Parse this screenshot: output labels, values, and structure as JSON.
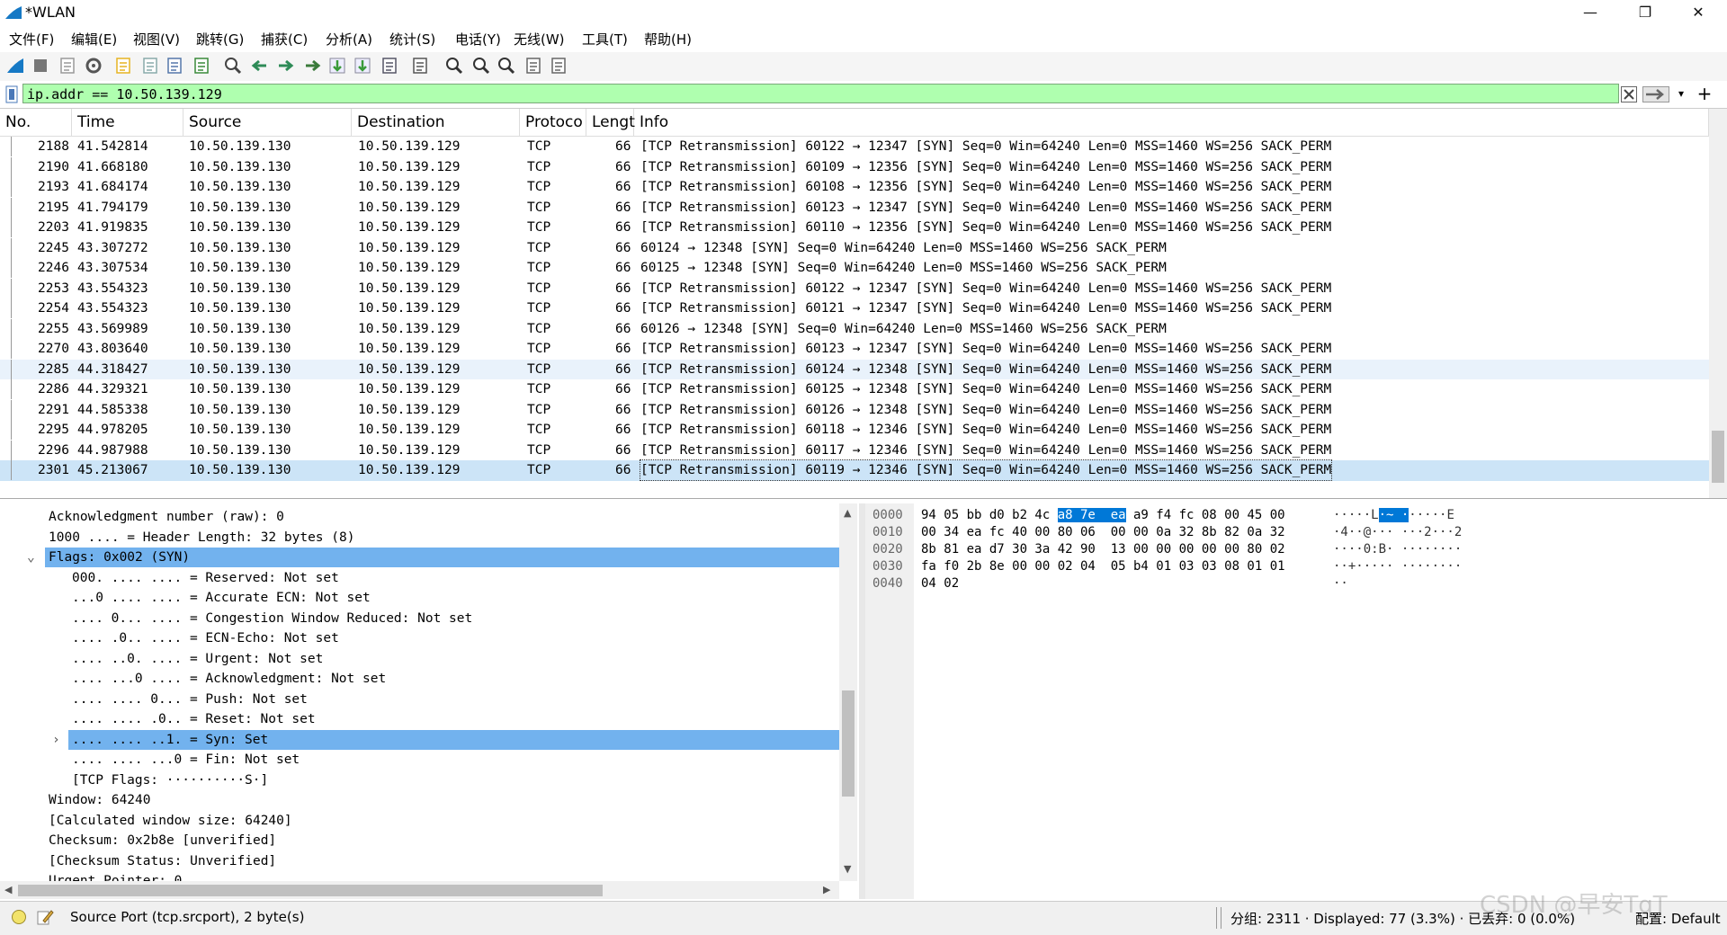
{
  "window": {
    "title": "*WLAN",
    "min_glyph": "—",
    "max_glyph": "❐",
    "close_glyph": "✕"
  },
  "menu": [
    "文件(F)",
    "编辑(E)",
    "视图(V)",
    "跳转(G)",
    "捕获(C)",
    "分析(A)",
    "统计(S)",
    "电话(Y)",
    "无线(W)",
    "工具(T)",
    "帮助(H)"
  ],
  "toolbar_icons": [
    "shark-fin-start-icon",
    "stop-capture-icon",
    "restart-capture-icon",
    "capture-options-icon",
    "open-file-icon",
    "save-file-icon",
    "close-file-icon",
    "reload-icon",
    "find-icon",
    "go-back-icon",
    "go-forward-icon",
    "go-to-packet-icon",
    "first-packet-icon",
    "last-packet-icon",
    "auto-scroll-icon",
    "colorize-icon",
    "zoom-in-icon",
    "zoom-out-icon",
    "zoom-reset-icon",
    "resize-columns-icon",
    "layout-icon"
  ],
  "filter": {
    "value": "ip.addr == 10.50.139.129",
    "plus": "+"
  },
  "packet_list": {
    "columns": [
      "No.",
      "Time",
      "Source",
      "Destination",
      "Protoco",
      "Lengt",
      "Info"
    ],
    "rows": [
      {
        "no": "2188",
        "time": "41.542814",
        "src": "10.50.139.130",
        "dst": "10.50.139.129",
        "proto": "TCP",
        "len": "66",
        "info": "[TCP Retransmission] 60122 → 12347 [SYN] Seq=0 Win=64240 Len=0 MSS=1460 WS=256 SACK_PERM"
      },
      {
        "no": "2190",
        "time": "41.668180",
        "src": "10.50.139.130",
        "dst": "10.50.139.129",
        "proto": "TCP",
        "len": "66",
        "info": "[TCP Retransmission] 60109 → 12356 [SYN] Seq=0 Win=64240 Len=0 MSS=1460 WS=256 SACK_PERM"
      },
      {
        "no": "2193",
        "time": "41.684174",
        "src": "10.50.139.130",
        "dst": "10.50.139.129",
        "proto": "TCP",
        "len": "66",
        "info": "[TCP Retransmission] 60108 → 12356 [SYN] Seq=0 Win=64240 Len=0 MSS=1460 WS=256 SACK_PERM"
      },
      {
        "no": "2195",
        "time": "41.794179",
        "src": "10.50.139.130",
        "dst": "10.50.139.129",
        "proto": "TCP",
        "len": "66",
        "info": "[TCP Retransmission] 60123 → 12347 [SYN] Seq=0 Win=64240 Len=0 MSS=1460 WS=256 SACK_PERM"
      },
      {
        "no": "2203",
        "time": "41.919835",
        "src": "10.50.139.130",
        "dst": "10.50.139.129",
        "proto": "TCP",
        "len": "66",
        "info": "[TCP Retransmission] 60110 → 12356 [SYN] Seq=0 Win=64240 Len=0 MSS=1460 WS=256 SACK_PERM"
      },
      {
        "no": "2245",
        "time": "43.307272",
        "src": "10.50.139.130",
        "dst": "10.50.139.129",
        "proto": "TCP",
        "len": "66",
        "info": "60124 → 12348 [SYN] Seq=0 Win=64240 Len=0 MSS=1460 WS=256 SACK_PERM"
      },
      {
        "no": "2246",
        "time": "43.307534",
        "src": "10.50.139.130",
        "dst": "10.50.139.129",
        "proto": "TCP",
        "len": "66",
        "info": "60125 → 12348 [SYN] Seq=0 Win=64240 Len=0 MSS=1460 WS=256 SACK_PERM"
      },
      {
        "no": "2253",
        "time": "43.554323",
        "src": "10.50.139.130",
        "dst": "10.50.139.129",
        "proto": "TCP",
        "len": "66",
        "info": "[TCP Retransmission] 60122 → 12347 [SYN] Seq=0 Win=64240 Len=0 MSS=1460 WS=256 SACK_PERM"
      },
      {
        "no": "2254",
        "time": "43.554323",
        "src": "10.50.139.130",
        "dst": "10.50.139.129",
        "proto": "TCP",
        "len": "66",
        "info": "[TCP Retransmission] 60121 → 12347 [SYN] Seq=0 Win=64240 Len=0 MSS=1460 WS=256 SACK_PERM"
      },
      {
        "no": "2255",
        "time": "43.569989",
        "src": "10.50.139.130",
        "dst": "10.50.139.129",
        "proto": "TCP",
        "len": "66",
        "info": "60126 → 12348 [SYN] Seq=0 Win=64240 Len=0 MSS=1460 WS=256 SACK_PERM"
      },
      {
        "no": "2270",
        "time": "43.803640",
        "src": "10.50.139.130",
        "dst": "10.50.139.129",
        "proto": "TCP",
        "len": "66",
        "info": "[TCP Retransmission] 60123 → 12347 [SYN] Seq=0 Win=64240 Len=0 MSS=1460 WS=256 SACK_PERM"
      },
      {
        "no": "2285",
        "time": "44.318427",
        "src": "10.50.139.130",
        "dst": "10.50.139.129",
        "proto": "TCP",
        "len": "66",
        "info": "[TCP Retransmission] 60124 → 12348 [SYN] Seq=0 Win=64240 Len=0 MSS=1460 WS=256 SACK_PERM"
      },
      {
        "no": "2286",
        "time": "44.329321",
        "src": "10.50.139.130",
        "dst": "10.50.139.129",
        "proto": "TCP",
        "len": "66",
        "info": "[TCP Retransmission] 60125 → 12348 [SYN] Seq=0 Win=64240 Len=0 MSS=1460 WS=256 SACK_PERM"
      },
      {
        "no": "2291",
        "time": "44.585338",
        "src": "10.50.139.130",
        "dst": "10.50.139.129",
        "proto": "TCP",
        "len": "66",
        "info": "[TCP Retransmission] 60126 → 12348 [SYN] Seq=0 Win=64240 Len=0 MSS=1460 WS=256 SACK_PERM"
      },
      {
        "no": "2295",
        "time": "44.978205",
        "src": "10.50.139.130",
        "dst": "10.50.139.129",
        "proto": "TCP",
        "len": "66",
        "info": "[TCP Retransmission] 60118 → 12346 [SYN] Seq=0 Win=64240 Len=0 MSS=1460 WS=256 SACK_PERM"
      },
      {
        "no": "2296",
        "time": "44.987988",
        "src": "10.50.139.130",
        "dst": "10.50.139.129",
        "proto": "TCP",
        "len": "66",
        "info": "[TCP Retransmission] 60117 → 12346 [SYN] Seq=0 Win=64240 Len=0 MSS=1460 WS=256 SACK_PERM"
      },
      {
        "no": "2301",
        "time": "45.213067",
        "src": "10.50.139.130",
        "dst": "10.50.139.129",
        "proto": "TCP",
        "len": "66",
        "info": "[TCP Retransmission] 60119 → 12346 [SYN] Seq=0 Win=64240 Len=0 MSS=1460 WS=256 SACK_PERM"
      }
    ]
  },
  "details": [
    {
      "indent": 0,
      "text": "Acknowledgment number (raw): 0"
    },
    {
      "indent": 0,
      "text": "1000 .... = Header Length: 32 bytes (8)"
    },
    {
      "indent": 0,
      "text": "Flags: 0x002 (SYN)",
      "expander": "⌄",
      "selected": true
    },
    {
      "indent": 1,
      "text": "000. .... .... = Reserved: Not set"
    },
    {
      "indent": 1,
      "text": "...0 .... .... = Accurate ECN: Not set"
    },
    {
      "indent": 1,
      "text": ".... 0... .... = Congestion Window Reduced: Not set"
    },
    {
      "indent": 1,
      "text": ".... .0.. .... = ECN-Echo: Not set"
    },
    {
      "indent": 1,
      "text": ".... ..0. .... = Urgent: Not set"
    },
    {
      "indent": 1,
      "text": ".... ...0 .... = Acknowledgment: Not set"
    },
    {
      "indent": 1,
      "text": ".... .... 0... = Push: Not set"
    },
    {
      "indent": 1,
      "text": ".... .... .0.. = Reset: Not set"
    },
    {
      "indent": 1,
      "text": ".... .... ..1. = Syn: Set",
      "expander": "›",
      "selected": true
    },
    {
      "indent": 1,
      "text": ".... .... ...0 = Fin: Not set"
    },
    {
      "indent": 1,
      "text": "[TCP Flags: ··········S·]"
    },
    {
      "indent": 0,
      "text": "Window: 64240"
    },
    {
      "indent": 0,
      "text": "[Calculated window size: 64240]"
    },
    {
      "indent": 0,
      "text": "Checksum: 0x2b8e [unverified]"
    },
    {
      "indent": 0,
      "text": "[Checksum Status: Unverified]"
    },
    {
      "indent": 0,
      "text": "Urgent Pointer: 0"
    }
  ],
  "bytes": [
    {
      "off": "0000",
      "pre": "94 05 bb d0 b2 4c ",
      "sel": "a8 7e  ea",
      "post": " a9 f4 fc 08 00 45 00",
      "apre": "·····L",
      "asel": "·~ ·",
      "apost": "·····E"
    },
    {
      "off": "0010",
      "pre": "00 34 ea fc 40 00 80 06  00 00 0a 32 8b 82 0a 32",
      "sel": "",
      "post": "",
      "apre": "·4··@··· ···2···2",
      "asel": "",
      "apost": ""
    },
    {
      "off": "0020",
      "pre": "8b 81 ea d7 30 3a 42 90  13 00 00 00 00 00 80 02",
      "sel": "",
      "post": "",
      "apre": "····0:B· ········",
      "asel": "",
      "apost": ""
    },
    {
      "off": "0030",
      "pre": "fa f0 2b 8e 00 00 02 04  05 b4 01 03 03 08 01 01",
      "sel": "",
      "post": "",
      "apre": "··+····· ········",
      "asel": "",
      "apost": ""
    },
    {
      "off": "0040",
      "pre": "04 02",
      "sel": "",
      "post": "",
      "apre": "··",
      "asel": "",
      "apost": ""
    }
  ],
  "status": {
    "field": "Source Port (tcp.srcport), 2 byte(s)",
    "counts": "分组: 2311 · Displayed: 77 (3.3%) · 已丢弃: 0 (0.0%)",
    "profile": "配置: Default"
  },
  "watermark": "CSDN @早安TqT",
  "colors": {
    "filter_valid": "#afffaf",
    "row_selected": "#cce4f7",
    "detail_selected": "#72b2ee",
    "byte_selected": "#0078d7"
  }
}
